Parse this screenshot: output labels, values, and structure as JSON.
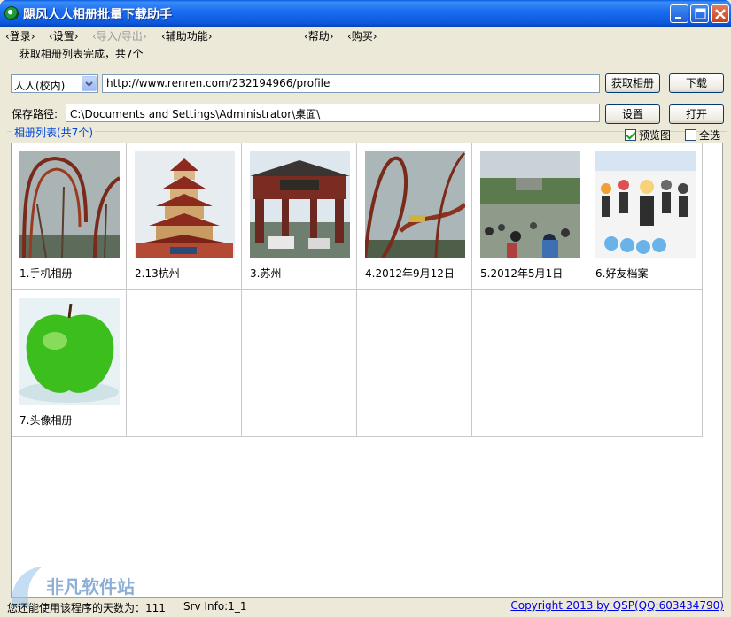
{
  "window": {
    "title": "飓风人人相册批量下载助手"
  },
  "menu": [
    {
      "label": "‹登录›",
      "enabled": true
    },
    {
      "label": "‹设置›",
      "enabled": true
    },
    {
      "label": "‹导入/导出›",
      "enabled": false
    },
    {
      "label": "‹辅助功能›",
      "enabled": true
    },
    {
      "label": "‹帮助›",
      "enabled": true
    },
    {
      "label": "‹购买›",
      "enabled": true
    }
  ],
  "status_message": "获取相册列表完成，共7个",
  "source": {
    "selected": "人人(校内)",
    "url": "http://www.renren.com/232194966/profile",
    "fetch_button": "获取相册",
    "download_button": "下载"
  },
  "save": {
    "label": "保存路径:",
    "path": "C:\\Documents and Settings\\Administrator\\桌面\\",
    "settings_button": "设置",
    "open_button": "打开"
  },
  "albums_panel": {
    "title": "相册列表(共7个)",
    "preview_label": "预览图",
    "preview_checked": true,
    "select_all_label": "全选",
    "select_all_checked": false
  },
  "albums": [
    {
      "caption": "1.手机相册",
      "thumb": "roller-coaster"
    },
    {
      "caption": "2.13杭州",
      "thumb": "pagoda"
    },
    {
      "caption": "3.苏州",
      "thumb": "gate"
    },
    {
      "caption": "4.2012年9月12日",
      "thumb": "coaster-loop"
    },
    {
      "caption": "5.2012年5月1日",
      "thumb": "crowd"
    },
    {
      "caption": "6.好友档案",
      "thumb": "profile"
    },
    {
      "caption": "7.头像相册",
      "thumb": "apple"
    }
  ],
  "footer": {
    "days_label": "您还能使用该程序的天数为：111",
    "srv_info": "Srv Info:1_1",
    "copyright": "Copyright 2013 by QSP(QQ:603434790)",
    "watermark": "非凡软件站"
  }
}
